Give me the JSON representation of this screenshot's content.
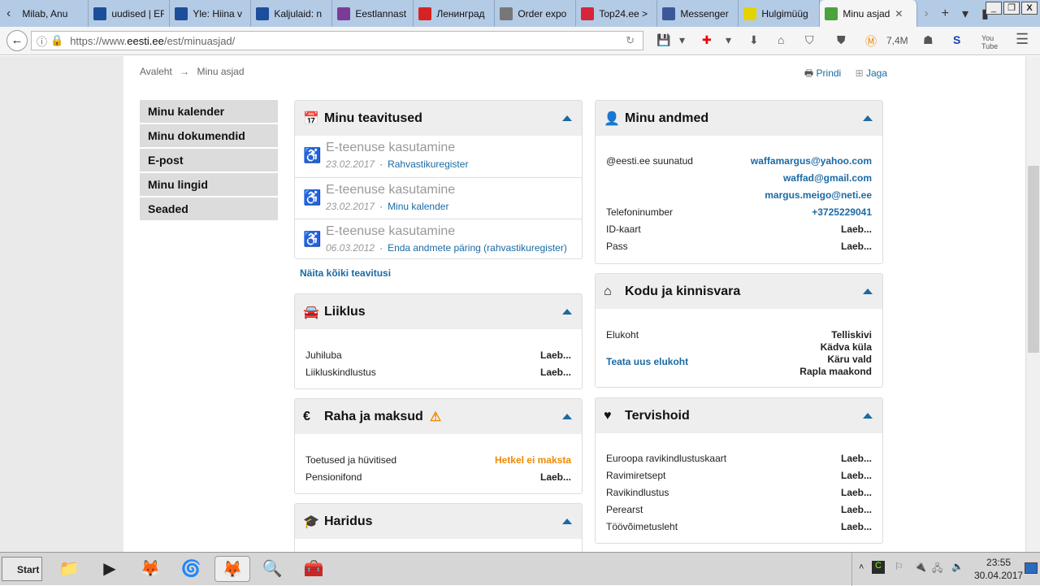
{
  "browser": {
    "tabs": [
      {
        "label": "Milab, Anu",
        "color": "#b4cbe6"
      },
      {
        "label": "uudised | ERR",
        "color": "#1b4f9c"
      },
      {
        "label": "Yle: Hiina v",
        "color": "#1b4f9c"
      },
      {
        "label": "Kaljulaid: n",
        "color": "#1b4f9c"
      },
      {
        "label": "Eestlannast",
        "color": "#7b3c98"
      },
      {
        "label": "Ленинград",
        "color": "#d62222"
      },
      {
        "label": "Order expo",
        "color": "#777"
      },
      {
        "label": "Top24.ee >",
        "color": "#d6263a"
      },
      {
        "label": "Messenger",
        "color": "#3b5998"
      },
      {
        "label": "Hulgimüüg",
        "color": "#e3d300"
      },
      {
        "label": "Minu asjad",
        "color": "#4aa33b"
      }
    ],
    "url_prefix": "https://www.",
    "url_host": "eesti.ee",
    "url_path": "/est/minuasjad/",
    "counter": "7,4M"
  },
  "page": {
    "breadcrumb": [
      "Avaleht",
      "→",
      "Minu asjad"
    ],
    "print": "Prindi",
    "share": "Jaga",
    "sidebar": [
      "Minu kalender",
      "Minu dokumendid",
      "E-post",
      "Minu lingid",
      "Seaded"
    ],
    "notifications": {
      "title": "Minu teavitused",
      "items": [
        {
          "title": "E-teenuse kasutamine",
          "date": "23.02.2017",
          "link": "Rahvastikuregister"
        },
        {
          "title": "E-teenuse kasutamine",
          "date": "23.02.2017",
          "link": "Minu kalender"
        },
        {
          "title": "E-teenuse kasutamine",
          "date": "06.03.2012",
          "link": "Enda andmete päring (rahvastikuregister)"
        }
      ],
      "show_all": "Näita kõiki teavitusi"
    },
    "liiklus": {
      "title": "Liiklus",
      "rows": [
        {
          "label": "Juhiluba",
          "value": "Laeb..."
        },
        {
          "label": "Liikluskindlustus",
          "value": "Laeb..."
        }
      ]
    },
    "raha": {
      "title": "Raha ja maksud",
      "rows": [
        {
          "label": "Toetused ja hüvitised",
          "value": "Hetkel ei maksta"
        },
        {
          "label": "Pensionifond",
          "value": "Laeb..."
        }
      ]
    },
    "haridus": {
      "title": "Haridus"
    },
    "andmed": {
      "title": "Minu andmed",
      "email_label": "@eesti.ee suunatud",
      "emails": [
        "waffamargus@yahoo.com",
        "waffad@gmail.com",
        "margus.meigo@neti.ee"
      ],
      "rows": [
        {
          "label": "Telefoninumber",
          "value": "+3725229041"
        },
        {
          "label": "ID-kaart",
          "value": "Laeb..."
        },
        {
          "label": "Pass",
          "value": "Laeb..."
        }
      ]
    },
    "kodu": {
      "title": "Kodu ja kinnisvara",
      "label": "Elukoht",
      "link": "Teata uus elukoht",
      "address": [
        "Telliskivi",
        "Kädva küla",
        "Käru vald",
        "Rapla maakond"
      ]
    },
    "tervis": {
      "title": "Tervishoid",
      "rows": [
        {
          "label": "Euroopa ravikindlustuskaart",
          "value": "Laeb..."
        },
        {
          "label": "Ravimiretsept",
          "value": "Laeb..."
        },
        {
          "label": "Ravikindlustus",
          "value": "Laeb..."
        },
        {
          "label": "Perearst",
          "value": "Laeb..."
        },
        {
          "label": "Töövõimetusleht",
          "value": "Laeb..."
        }
      ]
    }
  },
  "taskbar": {
    "start": "Start",
    "time": "23:55",
    "date": "30.04.2017"
  },
  "colors": {
    "link": "#1a6aa3",
    "warning": "#f08a00"
  }
}
